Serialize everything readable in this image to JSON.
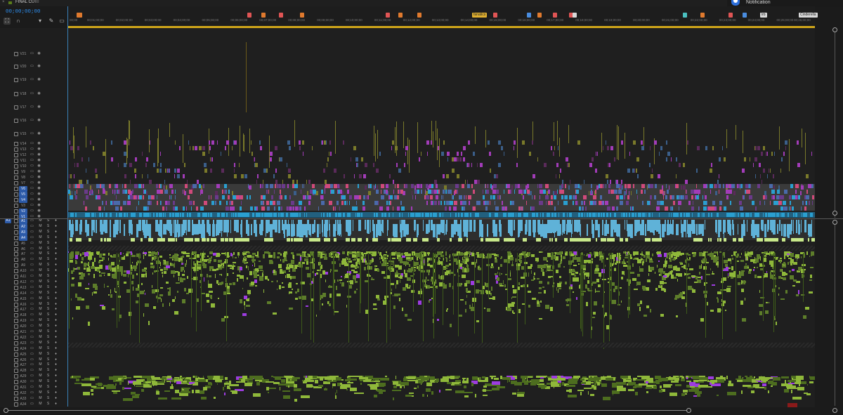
{
  "panel": {
    "tab_title": "FINAL CUT",
    "tab_close": "×",
    "tab_menu": "≡",
    "timecode": "00;00;00;00",
    "tools": [
      "snap-icon",
      "linked-selection-icon",
      "add-marker-icon",
      "wrench-icon",
      "captions-icon"
    ]
  },
  "notification": {
    "label": "Notification",
    "accent": "#2d6fdb"
  },
  "ruler": {
    "labels": [
      "00;00",
      "00;01;00;00",
      "00;02;00;00",
      "00;03;00;00",
      "00;04;00;00",
      "00;05;00;00",
      "00;06;00;00",
      "00;07;00;00",
      "00;08;00;00",
      "00;09;00;00",
      "00;10;00;00",
      "00;11;00;00",
      "00;12;00;00",
      "00;13;00;00",
      "00;14;00;00",
      "00;15;00;00",
      "00;16;00;00",
      "00;17;00;00",
      "00;18;00;00",
      "00;19;00;00",
      "00;20;00;00",
      "00;21;00;00",
      "00;22;00;00",
      "00;23;00;00",
      "00;24;00;00",
      "00;25;00;00",
      "00;26;00;00"
    ],
    "markers": [
      {
        "color": "#e07a2e",
        "label": ""
      },
      {
        "color": "#e07a2e",
        "label": ""
      },
      {
        "color": "#e05555",
        "label": ""
      },
      {
        "color": "#e07a2e",
        "label": ""
      },
      {
        "color": "#e05555",
        "label": ""
      },
      {
        "color": "#e07a2e",
        "label": ""
      },
      {
        "color": "#e05555",
        "label": ""
      },
      {
        "color": "#e07a2e",
        "label": ""
      },
      {
        "color": "#e07a2e",
        "label": ""
      },
      {
        "color": "#e0b030",
        "label": "fanatics"
      },
      {
        "color": "#e05555",
        "label": ""
      },
      {
        "color": "#4a8de0",
        "label": ""
      },
      {
        "color": "#e07a2e",
        "label": ""
      },
      {
        "color": "#e05555",
        "label": ""
      },
      {
        "color": "#e05555",
        "label": ""
      },
      {
        "color": "#d8d8d8",
        "label": ""
      },
      {
        "color": "#4ac0c0",
        "label": ""
      },
      {
        "color": "#e07a2e",
        "label": ""
      },
      {
        "color": "#e05555",
        "label": ""
      },
      {
        "color": "#4a8de0",
        "label": ""
      },
      {
        "color": "#d8d8d8",
        "label": "lrb"
      },
      {
        "color": "#d8d8d8",
        "label": "Cinderella"
      }
    ],
    "workarea_color": "#cfa51a"
  },
  "video_tracks": [
    {
      "name": "V21",
      "on": false
    },
    {
      "name": "V20",
      "on": false
    },
    {
      "name": "V19",
      "on": false
    },
    {
      "name": "V18",
      "on": false
    },
    {
      "name": "V17",
      "on": false
    },
    {
      "name": "V16",
      "on": false
    },
    {
      "name": "V15",
      "on": false
    },
    {
      "name": "V14",
      "on": false
    },
    {
      "name": "V13",
      "on": false
    },
    {
      "name": "V12",
      "on": false
    },
    {
      "name": "V11",
      "on": false
    },
    {
      "name": "V10",
      "on": false
    },
    {
      "name": "V9",
      "on": false
    },
    {
      "name": "V8",
      "on": false
    },
    {
      "name": "V7",
      "on": false
    },
    {
      "name": "V6",
      "on": true
    },
    {
      "name": "V5",
      "on": true
    },
    {
      "name": "V4",
      "on": true
    },
    {
      "name": "V3",
      "on": false
    },
    {
      "name": "V2",
      "on": true
    },
    {
      "name": "V1",
      "on": true
    }
  ],
  "audio_source_patch": "A1",
  "audio_tracks": [
    "A1",
    "A2",
    "A3",
    "A4",
    "A5",
    "A6",
    "A7",
    "A8",
    "A9",
    "A10",
    "A11",
    "A12",
    "A13",
    "A14",
    "A15",
    "A16",
    "A17",
    "A18",
    "A19",
    "A20",
    "A21",
    "A22",
    "A23",
    "A24",
    "A25",
    "A26",
    "A27",
    "A28",
    "A29",
    "A30",
    "A31",
    "A32",
    "A33",
    "A34"
  ],
  "audio_on": [
    "A1",
    "A2",
    "A3",
    "A4"
  ],
  "audio_track_buttons": {
    "mute": "M",
    "solo": "S"
  },
  "colors": {
    "playhead": "#3a7fb5",
    "video_teal": "#2a9fd0",
    "video_magenta": "#a23cb8",
    "video_olive": "#7a7a2a",
    "audio_green": "#8fb83a",
    "audio_purple": "#9d3ce0"
  }
}
